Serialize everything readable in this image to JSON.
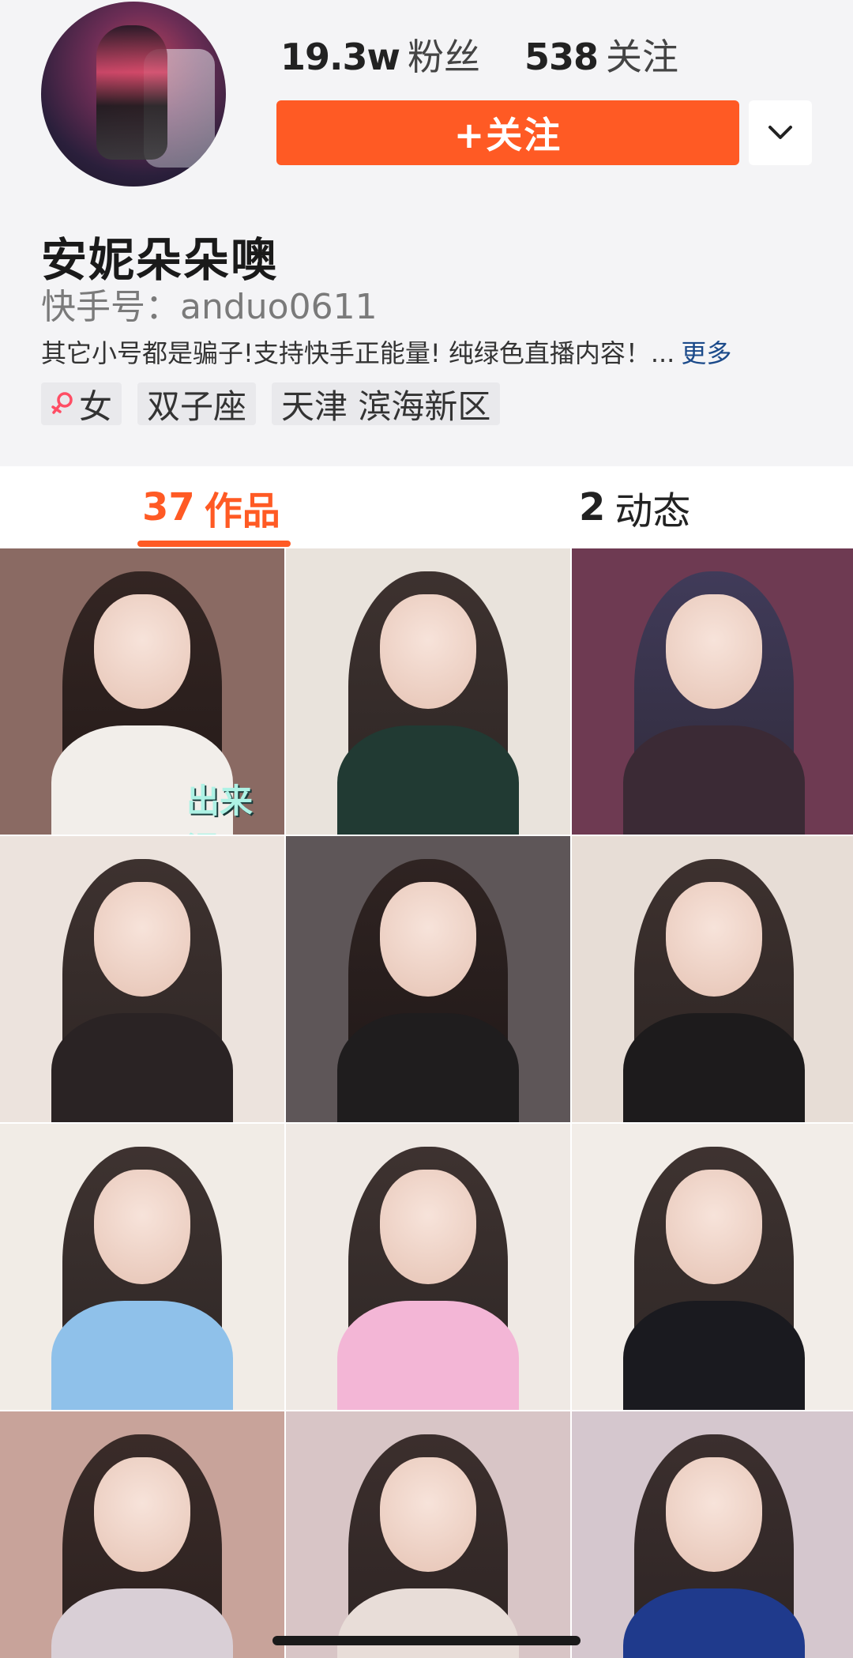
{
  "profile": {
    "followers_count": "19.3w",
    "followers_label": "粉丝",
    "following_count": "538",
    "following_label": "关注",
    "follow_button": "+关注",
    "name": "安妮朵朵噢",
    "kuaishou_id": "快手号：anduo0611",
    "bio": "其它小号都是骗子!支持快手正能量! 纯绿色直播内容！...",
    "bio_more": "更多",
    "tags": [
      {
        "icon": "female-icon",
        "label": "女"
      },
      {
        "label": "双子座"
      },
      {
        "label": "天津 滨海新区"
      }
    ]
  },
  "tabs": {
    "works_count": "37",
    "works_label": "作品",
    "moments_count": "2",
    "moments_label": "动态"
  },
  "grid": {
    "items": [
      {
        "overlay_text": "出来混",
        "bg": "#8a6a63"
      },
      {
        "bg": "#e9e3dc"
      },
      {
        "bg": "#6e3a52"
      },
      {
        "bg": "#ece3dd"
      },
      {
        "bg": "#5e5658"
      },
      {
        "bg": "#e7ddd6"
      },
      {
        "bg": "#f1ece6"
      },
      {
        "bg": "#efe9e4"
      },
      {
        "bg": "#f2ede8"
      },
      {
        "bg": "#c8a39a"
      },
      {
        "bg": "#d8c5c6"
      },
      {
        "bg": "#d5c7ce"
      }
    ]
  },
  "colors": {
    "accent": "#ff5a24",
    "more_link": "#1b4a8a",
    "gender_icon": "#ff4d64"
  }
}
